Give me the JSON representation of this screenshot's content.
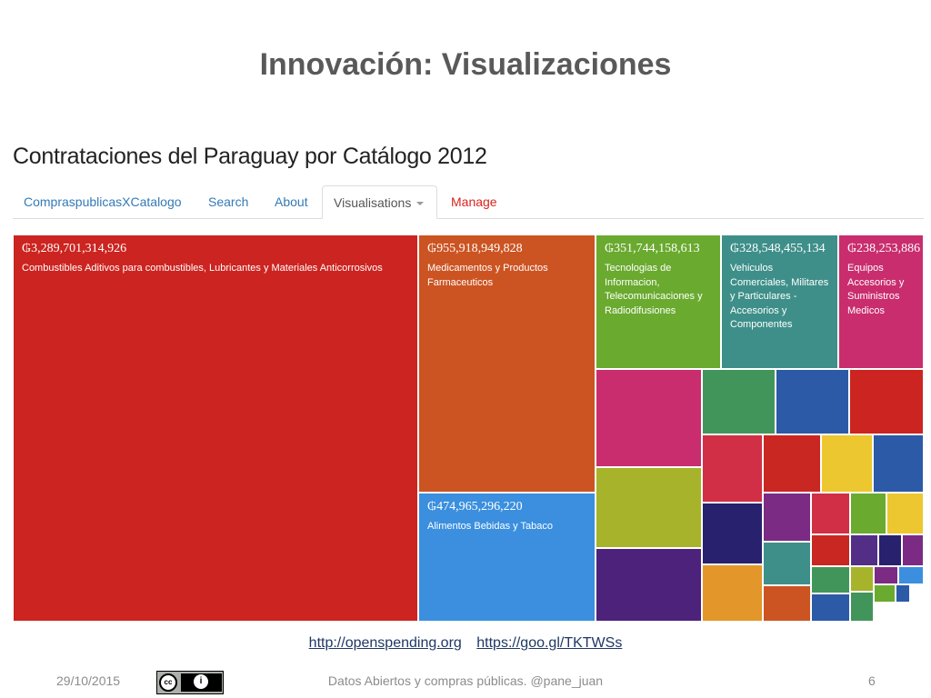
{
  "slide": {
    "title": "Innovación: Visualizaciones",
    "links": [
      "http://openspending.org",
      "https://goo.gl/TKTWSs"
    ],
    "footer": {
      "date": "29/10/2015",
      "license_icon": "creative-commons-by-icon",
      "text": "Datos Abiertos y compras públicas. @pane_juan",
      "page": "6"
    }
  },
  "app": {
    "title": "Contrataciones del Paraguay por Catálogo 2012",
    "nav": [
      {
        "label": "CompraspublicasXCatalogo"
      },
      {
        "label": "Search"
      },
      {
        "label": "About"
      },
      {
        "label": "Visualisations",
        "active": true
      },
      {
        "label": "Manage"
      }
    ]
  },
  "chart_data": {
    "type": "treemap",
    "currency_symbol": "₲",
    "labeled_tiles": [
      {
        "amount": "₲3,289,701,314,926",
        "value": 3289701314926,
        "label": "Combustibles Aditivos para combustibles, Lubricantes y Materiales Anticorrosivos",
        "color": "#cc2420"
      },
      {
        "amount": "₲955,918,949,828",
        "value": 955918949828,
        "label": "Medicamentos y Productos Farmaceuticos",
        "color": "#cc5422"
      },
      {
        "amount": "₲474,965,296,220",
        "value": 474965296220,
        "label": "Alimentos Bebidas y Tabaco",
        "color": "#3b8fde"
      },
      {
        "amount": "₲351,744,158,613",
        "value": 351744158613,
        "label": "Tecnologias de Informacion, Telecomunicaciones y Radiodifusiones",
        "color": "#6aaa2f"
      },
      {
        "amount": "₲328,548,455,134",
        "value": 328548455134,
        "label": "Vehiculos Comerciales, Militares y Particulares - Accesorios y Componentes",
        "color": "#3e8f89"
      },
      {
        "amount": "₲238,253,886",
        "value": 238253886,
        "label": "Equipos Accesorios y Suministros Medicos",
        "color": "#c92d6e"
      }
    ],
    "unlabeled_tile_colors": [
      "#c92d6e",
      "#42955a",
      "#2c5aa6",
      "#cc2420",
      "#a7b32a",
      "#d12f45",
      "#c92722",
      "#ecc72f",
      "#2c5aa6",
      "#27216e",
      "#7b2b83",
      "#d12f45",
      "#6aaa2f",
      "#ecc72f",
      "#4d227a",
      "#e3972a",
      "#3e8f89",
      "#c92722",
      "#532e87",
      "#27216e",
      "#7b2b83",
      "#cc5422",
      "#42955a",
      "#2c5aa6",
      "#a7b32a",
      "#7b2b83",
      "#3b8fde",
      "#42955a",
      "#6aaa2f",
      "#2c5aa6"
    ]
  }
}
